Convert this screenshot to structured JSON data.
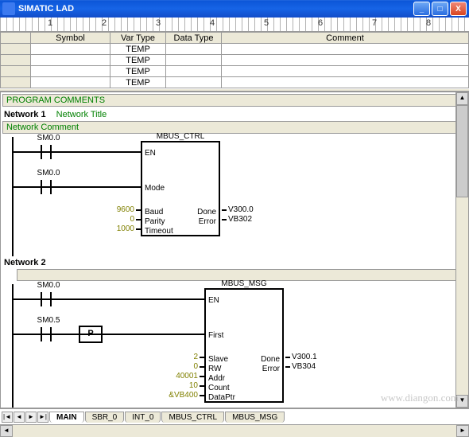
{
  "window": {
    "title": "SIMATIC LAD"
  },
  "ruler": {
    "marks": [
      "1",
      "2",
      "3",
      "4",
      "5",
      "6",
      "7",
      "8"
    ]
  },
  "var_table": {
    "headers": {
      "symbol": "Symbol",
      "var_type": "Var Type",
      "data_type": "Data Type",
      "comment": "Comment"
    },
    "rows": [
      {
        "symbol": "",
        "var_type": "TEMP",
        "data_type": "",
        "comment": ""
      },
      {
        "symbol": "",
        "var_type": "TEMP",
        "data_type": "",
        "comment": ""
      },
      {
        "symbol": "",
        "var_type": "TEMP",
        "data_type": "",
        "comment": ""
      },
      {
        "symbol": "",
        "var_type": "TEMP",
        "data_type": "",
        "comment": ""
      }
    ]
  },
  "program_comments_label": "PROGRAM COMMENTS",
  "network1": {
    "header": "Network 1",
    "title": "Network Title",
    "comment": "Network Comment",
    "contact1": "SM0.0",
    "contact2": "SM0.0",
    "block": {
      "name": "MBUS_CTRL",
      "pins_left": {
        "en": "EN",
        "mode": "Mode",
        "baud": "Baud",
        "parity": "Parity",
        "timeout": "Timeout"
      },
      "pins_right": {
        "done": "Done",
        "error": "Error"
      },
      "vals": {
        "baud": "9600",
        "parity": "0",
        "timeout": "1000"
      },
      "outs": {
        "done": "V300.0",
        "error": "VB302"
      }
    }
  },
  "network2": {
    "header": "Network 2",
    "contact1": "SM0.0",
    "contact2": "SM0.5",
    "edge": "P",
    "block": {
      "name": "MBUS_MSG",
      "pins_left": {
        "en": "EN",
        "first": "First",
        "slave": "Slave",
        "rw": "RW",
        "addr": "Addr",
        "count": "Count",
        "dataptr": "DataPtr"
      },
      "pins_right": {
        "done": "Done",
        "error": "Error"
      },
      "vals": {
        "slave": "2",
        "rw": "0",
        "addr": "40001",
        "count": "10",
        "dataptr": "&VB400"
      },
      "outs": {
        "done": "V300.1",
        "error": "VB304"
      }
    }
  },
  "tabs": {
    "items": [
      "MAIN",
      "SBR_0",
      "INT_0",
      "MBUS_CTRL",
      "MBUS_MSG"
    ],
    "active": 0
  },
  "watermark": "www.diangon.com"
}
